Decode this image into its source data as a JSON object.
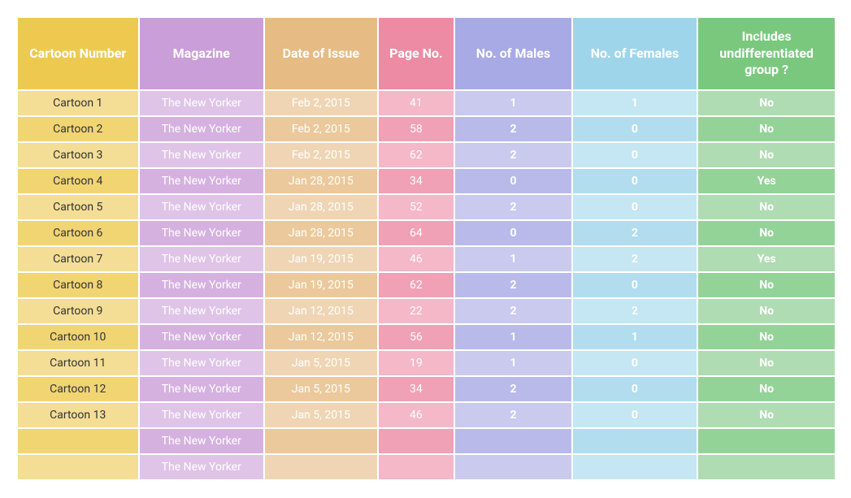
{
  "headers": [
    "Cartoon Number",
    "Magazine",
    "Date of Issue",
    "Page No.",
    "No. of Males",
    "No. of Females",
    "Includes undifferentiated group ?"
  ],
  "rows": [
    {
      "cartoon": "Cartoon 1",
      "magazine": "The New Yorker",
      "date": "Feb 2, 2015",
      "page": "41",
      "males": "1",
      "females": "1",
      "undiff": "No"
    },
    {
      "cartoon": "Cartoon 2",
      "magazine": "The New Yorker",
      "date": "Feb 2, 2015",
      "page": "58",
      "males": "2",
      "females": "0",
      "undiff": "No"
    },
    {
      "cartoon": "Cartoon 3",
      "magazine": "The New Yorker",
      "date": "Feb 2, 2015",
      "page": "62",
      "males": "2",
      "females": "0",
      "undiff": "No"
    },
    {
      "cartoon": "Cartoon 4",
      "magazine": "The New Yorker",
      "date": "Jan 28, 2015",
      "page": "34",
      "males": "0",
      "females": "0",
      "undiff": "Yes"
    },
    {
      "cartoon": "Cartoon 5",
      "magazine": "The New Yorker",
      "date": "Jan 28, 2015",
      "page": "52",
      "males": "2",
      "females": "0",
      "undiff": "No"
    },
    {
      "cartoon": "Cartoon 6",
      "magazine": "The New Yorker",
      "date": "Jan 28, 2015",
      "page": "64",
      "males": "0",
      "females": "2",
      "undiff": "No"
    },
    {
      "cartoon": "Cartoon 7",
      "magazine": "The New Yorker",
      "date": "Jan 19, 2015",
      "page": "46",
      "males": "1",
      "females": "2",
      "undiff": "Yes"
    },
    {
      "cartoon": "Cartoon 8",
      "magazine": "The New Yorker",
      "date": "Jan 19, 2015",
      "page": "62",
      "males": "2",
      "females": "0",
      "undiff": "No"
    },
    {
      "cartoon": "Cartoon 9",
      "magazine": "The New Yorker",
      "date": "Jan 12, 2015",
      "page": "22",
      "males": "2",
      "females": "2",
      "undiff": "No"
    },
    {
      "cartoon": "Cartoon 10",
      "magazine": "The New Yorker",
      "date": "Jan 12, 2015",
      "page": "56",
      "males": "1",
      "females": "1",
      "undiff": "No"
    },
    {
      "cartoon": "Cartoon 11",
      "magazine": "The New Yorker",
      "date": "Jan 5, 2015",
      "page": "19",
      "males": "1",
      "females": "0",
      "undiff": "No"
    },
    {
      "cartoon": "Cartoon 12",
      "magazine": "The New Yorker",
      "date": "Jan 5, 2015",
      "page": "34",
      "males": "2",
      "females": "0",
      "undiff": "No"
    },
    {
      "cartoon": "Cartoon 13",
      "magazine": "The New Yorker",
      "date": "Jan 5, 2015",
      "page": "46",
      "males": "2",
      "females": "0",
      "undiff": "No"
    },
    {
      "cartoon": "",
      "magazine": "The New Yorker",
      "date": "",
      "page": "",
      "males": "",
      "females": "",
      "undiff": ""
    },
    {
      "cartoon": "",
      "magazine": "The New Yorker",
      "date": "",
      "page": "",
      "males": "",
      "females": "",
      "undiff": ""
    }
  ],
  "chart_data": {
    "type": "table",
    "title": "",
    "columns": [
      "Cartoon Number",
      "Magazine",
      "Date of Issue",
      "Page No.",
      "No. of Males",
      "No. of Females",
      "Includes undifferentiated group ?"
    ],
    "data": [
      [
        "Cartoon 1",
        "The New Yorker",
        "Feb 2, 2015",
        41,
        1,
        1,
        "No"
      ],
      [
        "Cartoon 2",
        "The New Yorker",
        "Feb 2, 2015",
        58,
        2,
        0,
        "No"
      ],
      [
        "Cartoon 3",
        "The New Yorker",
        "Feb 2, 2015",
        62,
        2,
        0,
        "No"
      ],
      [
        "Cartoon 4",
        "The New Yorker",
        "Jan 28, 2015",
        34,
        0,
        0,
        "Yes"
      ],
      [
        "Cartoon 5",
        "The New Yorker",
        "Jan 28, 2015",
        52,
        2,
        0,
        "No"
      ],
      [
        "Cartoon 6",
        "The New Yorker",
        "Jan 28, 2015",
        64,
        0,
        2,
        "No"
      ],
      [
        "Cartoon 7",
        "The New Yorker",
        "Jan 19, 2015",
        46,
        1,
        2,
        "Yes"
      ],
      [
        "Cartoon 8",
        "The New Yorker",
        "Jan 19, 2015",
        62,
        2,
        0,
        "No"
      ],
      [
        "Cartoon 9",
        "The New Yorker",
        "Jan 12, 2015",
        22,
        2,
        2,
        "No"
      ],
      [
        "Cartoon 10",
        "The New Yorker",
        "Jan 12, 2015",
        56,
        1,
        1,
        "No"
      ],
      [
        "Cartoon 11",
        "The New Yorker",
        "Jan 5, 2015",
        19,
        1,
        0,
        "No"
      ],
      [
        "Cartoon 12",
        "The New Yorker",
        "Jan 5, 2015",
        34,
        2,
        0,
        "No"
      ],
      [
        "Cartoon 13",
        "The New Yorker",
        "Jan 5, 2015",
        46,
        2,
        0,
        "No"
      ]
    ]
  }
}
